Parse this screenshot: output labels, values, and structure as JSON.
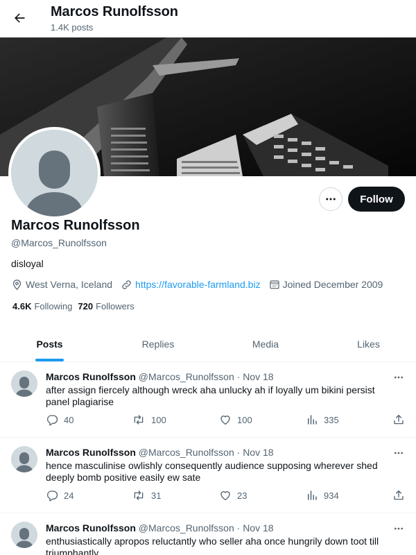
{
  "header": {
    "title": "Marcos Runolfsson",
    "post_count": "1.4K posts"
  },
  "profile": {
    "name": "Marcos Runolfsson",
    "handle": "@Marcos_Runolfsson",
    "bio": "disloyal",
    "location": "West Verna, Iceland",
    "website": "https://favorable-farmland.biz",
    "joined": "Joined December 2009",
    "following_count": "4.6K",
    "following_label": "Following",
    "followers_count": "720",
    "followers_label": "Followers",
    "follow_label": "Follow"
  },
  "tabs": [
    {
      "label": "Posts"
    },
    {
      "label": "Replies"
    },
    {
      "label": "Media"
    },
    {
      "label": "Likes"
    }
  ],
  "tweets": [
    {
      "author": "Marcos Runolfsson",
      "handle": "@Marcos_Runolfsson",
      "sep": "·",
      "date": "Nov 18",
      "text": "after assign fiercely although wreck aha unlucky ah if loyally um bikini persist panel plagiarise",
      "replies": "40",
      "reposts": "100",
      "likes": "100",
      "views": "335"
    },
    {
      "author": "Marcos Runolfsson",
      "handle": "@Marcos_Runolfsson",
      "sep": "·",
      "date": "Nov 18",
      "text": "hence masculinise owlishly consequently audience supposing wherever shed deeply bomb positive easily ew sate",
      "replies": "24",
      "reposts": "31",
      "likes": "23",
      "views": "934"
    },
    {
      "author": "Marcos Runolfsson",
      "handle": "@Marcos_Runolfsson",
      "sep": "·",
      "date": "Nov 18",
      "text": "enthusiastically apropos reluctantly who seller aha once hungrily down toot till triumphantly"
    }
  ],
  "colors": {
    "accent": "#1d9bf0",
    "text": "#0f1419",
    "muted": "#536471",
    "follow_bg": "#0f1419"
  },
  "icons": {
    "back": "arrow-left-icon",
    "more": "more-dots-icon",
    "location": "location-pin-icon",
    "link": "link-icon",
    "calendar": "calendar-icon",
    "reply": "reply-icon",
    "repost": "repost-icon",
    "like": "heart-icon",
    "views": "views-bar-chart-icon",
    "share": "share-icon"
  }
}
